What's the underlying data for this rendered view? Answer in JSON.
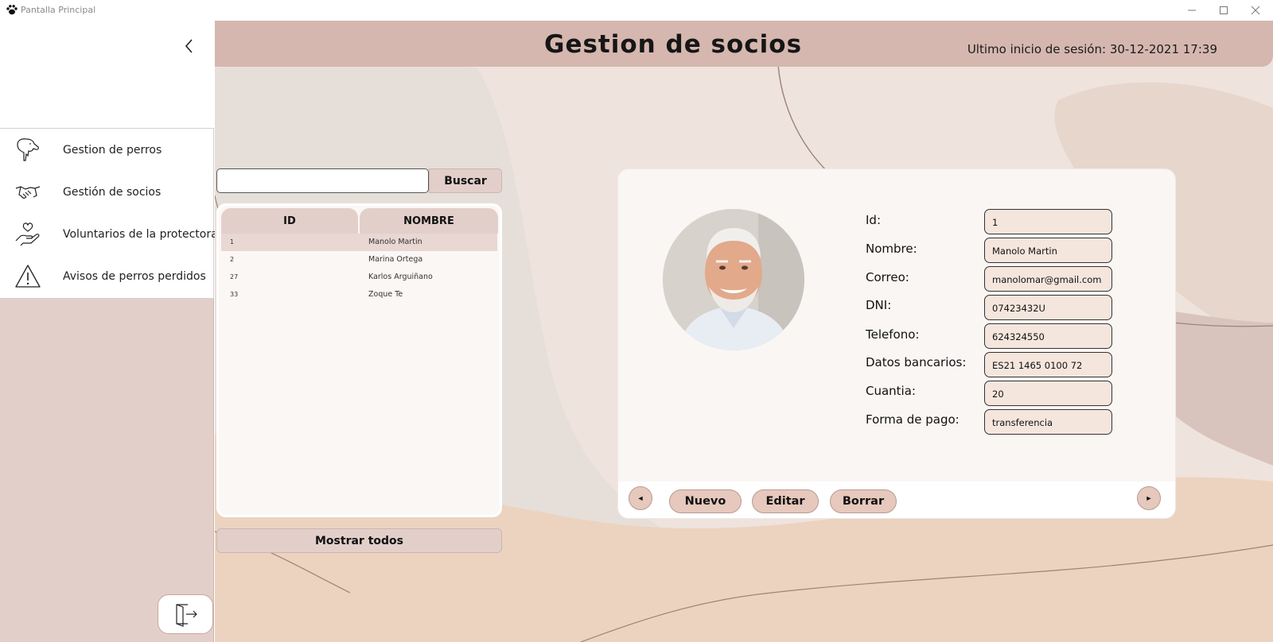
{
  "window": {
    "title": "Pantalla Principal",
    "controls": {
      "minimize": "minimize-icon",
      "maximize": "maximize-icon",
      "close": "close-icon"
    }
  },
  "header": {
    "title": "Gestion de socios",
    "last_login": "Ultimo inicio de sesión: 30-12-2021 17:39"
  },
  "sidebar": {
    "items": [
      {
        "label": "Gestion de perros",
        "icon": "dog-icon"
      },
      {
        "label": "Gestión de socios",
        "icon": "handshake-icon"
      },
      {
        "label": "Voluntarios de la protectora",
        "icon": "heart-hand-icon"
      },
      {
        "label": "Avisos de perros perdidos",
        "icon": "warning-icon"
      }
    ],
    "logout_icon": "logout-icon"
  },
  "search": {
    "value": "",
    "button_label": "Buscar"
  },
  "table": {
    "columns": [
      "ID",
      "NOMBRE"
    ],
    "rows": [
      {
        "id": "1",
        "name": "Manolo Martin",
        "selected": true
      },
      {
        "id": "2",
        "name": "Marina Ortega",
        "selected": false
      },
      {
        "id": "27",
        "name": "Karlos Arguiñano",
        "selected": false
      },
      {
        "id": "33",
        "name": "Zoque Te",
        "selected": false
      }
    ]
  },
  "show_all_label": "Mostrar todos",
  "detail": {
    "fields": [
      {
        "label": "Id:",
        "value": "1"
      },
      {
        "label": "Nombre:",
        "value": "Manolo Martin"
      },
      {
        "label": "Correo:",
        "value": "manolomar@gmail.com"
      },
      {
        "label": "DNI:",
        "value": "07423432U"
      },
      {
        "label": "Telefono:",
        "value": "624324550"
      },
      {
        "label": "Datos bancarios:",
        "value": "ES21 1465 0100 72"
      },
      {
        "label": "Cuantia:",
        "value": "20"
      },
      {
        "label": "Forma de pago:",
        "value": "transferencia"
      }
    ],
    "buttons": {
      "prev": "◄",
      "new": "Nuevo",
      "edit": "Editar",
      "delete": "Borrar",
      "next": "►"
    }
  },
  "colors": {
    "header": "#d5b7af",
    "sidebar": "#e3cfca",
    "input_fill": "#f5e6dd",
    "button_fill": "#e6c8bd"
  }
}
